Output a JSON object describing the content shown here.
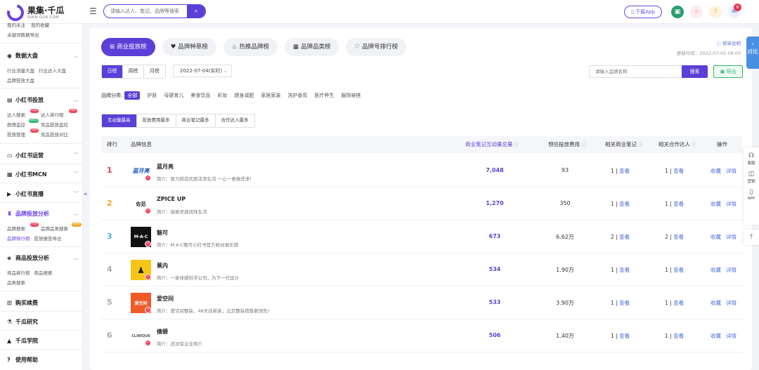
{
  "header": {
    "logo_title": "果集·千瓜",
    "logo_sub": "QIAN-GUA.COM",
    "search_placeholder": "请输入达人、笔记、品牌等搜索",
    "download_label": "下载App",
    "notif_count": "6"
  },
  "sidebar": {
    "top_links": [
      "我的关注",
      "我的收藏"
    ],
    "top_links2": [
      "关键词数据导出"
    ],
    "sections": {
      "data": {
        "title": "数据大盘",
        "rows": [
          [
            "行业流量大盘",
            "行业达人大盘"
          ],
          [
            "品牌投放大盘"
          ]
        ]
      },
      "xhs_ads": {
        "title": "小红书投放",
        "rows": [
          [
            "达人搜索",
            "达人排行榜"
          ],
          [
            "舆情监控",
            "竞品投放监控"
          ],
          [
            "投放管理",
            "竞品投放对比"
          ]
        ]
      },
      "xhs_ops": {
        "title": "小红书运营"
      },
      "mcn": {
        "title": "小红书MCN"
      },
      "live": {
        "title": "小红书直播"
      },
      "brand": {
        "title": "品牌投放分析",
        "rows": [
          [
            "品牌搜索",
            "品牌品类搜索"
          ],
          [
            "品牌排行榜",
            "投放报告导出"
          ]
        ]
      },
      "goods": {
        "title": "商品投放分析",
        "rows": [
          [
            "商品排行榜",
            "商品搜索"
          ],
          [
            "品类搜索"
          ]
        ]
      },
      "buy": {
        "title": "购买续费"
      },
      "research": {
        "title": "千瓜研究"
      },
      "academy": {
        "title": "千瓜学院"
      },
      "help": {
        "title": "使用帮助"
      }
    },
    "tags": {
      "hot": "Hot",
      "beta": "Beta",
      "new": "New"
    }
  },
  "main": {
    "tabs": [
      "商业投放榜",
      "品牌种草榜",
      "热推品牌榜",
      "品牌品类榜",
      "品牌号排行榜"
    ],
    "rule_link": "榜单说明",
    "update_time": "更新时间：2022-07-05 08:00",
    "periods": [
      "日榜",
      "周榜",
      "月榜"
    ],
    "date_value": "2022-07-04(实时)",
    "brand_placeholder": "请输入品牌名称",
    "search_label": "搜索",
    "export_label": "导出",
    "category_label": "品牌分类:",
    "categories": [
      "全部",
      "护肤",
      "母婴育儿",
      "美食饮品",
      "彩妆",
      "健身减肥",
      "家居家装",
      "洗护香氛",
      "医疗养生",
      "服饰穿搭"
    ],
    "sort_tabs": [
      "互动量最高",
      "投放费用最多",
      "商业笔记最多",
      "合作达人最多"
    ],
    "columns": {
      "rank": "排行",
      "brand": "品牌信息",
      "interaction": "商业笔记互动量总量",
      "fee": "预估投放费用",
      "notes": "相关商业笔记",
      "kols": "相关合作达人",
      "ops": "操作"
    },
    "view_label": "查看",
    "fav_label": "收藏",
    "detail_label": "详情",
    "rows": [
      {
        "rank": "1",
        "name": "蓝月亮",
        "logo": "蓝月亮",
        "intro": "简介：致力缔造优质洁净生活 一心一意做洗涤!",
        "interaction": "7,048",
        "fee": "93",
        "notes": "1",
        "kols": "1"
      },
      {
        "rank": "2",
        "name": "ZPICE UP",
        "logo": "佐范",
        "intro": "简介：探索灵感风味生活",
        "interaction": "1,270",
        "fee": "350",
        "notes": "1",
        "kols": "1"
      },
      {
        "rank": "3",
        "name": "魅可",
        "logo": "M·A·C",
        "intro": "简介：M·A·C魅可小红书官方粉丝俱乐部",
        "interaction": "673",
        "fee": "6.62万",
        "notes": "2",
        "kols": "2"
      },
      {
        "rank": "4",
        "name": "蕉内",
        "logo": "",
        "intro": "简介：一家体感科学公司，为下一代设计",
        "interaction": "534",
        "fee": "1.90万",
        "notes": "1",
        "kols": "1"
      },
      {
        "rank": "5",
        "name": "爱空间",
        "logo": "爱空间",
        "intro": "简介：爱空间整装，48天住新家，北京整装销售额领先!",
        "interaction": "533",
        "fee": "3.90万",
        "notes": "1",
        "kols": "1"
      },
      {
        "rank": "6",
        "name": "倩碧",
        "logo": "CLINIQUE",
        "intro": "简介：还没有企业简介",
        "interaction": "506",
        "fee": "1.40万",
        "notes": "1",
        "kols": "1"
      }
    ]
  },
  "right_float": {
    "compare": "对比",
    "items": [
      "客服",
      "营销",
      "APP"
    ]
  },
  "colors": {
    "accent": "#5b3fd6",
    "rank1": "#e8384f",
    "rank2": "#f5a623",
    "rank3": "#4ab5c7",
    "rank_other": "#aaaaaa"
  }
}
